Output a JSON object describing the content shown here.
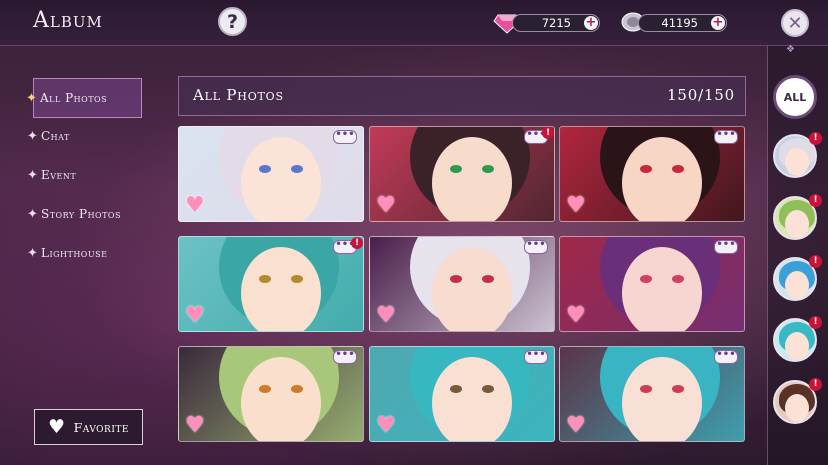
{
  "header": {
    "title": "Album",
    "help_label": "?",
    "close_label": "✕"
  },
  "currencies": [
    {
      "name": "gems",
      "value": "7215",
      "plus": "+",
      "color": "#e84f9d"
    },
    {
      "name": "coins",
      "value": "41195",
      "plus": "+",
      "color": "#b8b3c3"
    }
  ],
  "sidebar": {
    "items": [
      {
        "label": "All Photos",
        "active": true
      },
      {
        "label": "Chat"
      },
      {
        "label": "Event"
      },
      {
        "label": "Story Photos"
      },
      {
        "label": "Lighthouse"
      }
    ],
    "favorite_label": "Favorite"
  },
  "main": {
    "section_title": "All Photos",
    "count": "150/150"
  },
  "photos": [
    {
      "hair": "#e3dbe8",
      "bg": "#d9e2f0",
      "skin": "#fbe3d8",
      "eye": "#5a78c8",
      "chat": "•••",
      "alert": false
    },
    {
      "hair": "#3a2228",
      "bg": "#c23a58",
      "skin": "#f8dccb",
      "eye": "#2f9a4a",
      "chat": "•••",
      "alert": true
    },
    {
      "hair": "#2b1418",
      "bg": "#b0263e",
      "skin": "#f7d6c6",
      "eye": "#c8283a",
      "chat": "•••",
      "alert": false
    },
    {
      "hair": "#3aa7a6",
      "bg": "#6cc2c5",
      "skin": "#f9e0cf",
      "eye": "#b58a2c",
      "chat": "•••",
      "alert": true
    },
    {
      "hair": "#e6e3ec",
      "bg": "#4a1e4a",
      "skin": "#f8dccf",
      "eye": "#c4304a",
      "chat": "•••",
      "alert": false
    },
    {
      "hair": "#6b2f7a",
      "bg": "#a02848",
      "skin": "#f7d5d0",
      "eye": "#d04060",
      "chat": "•••",
      "alert": false
    },
    {
      "hair": "#a9c77a",
      "bg": "#3a2a3c",
      "skin": "#f9dfcc",
      "eye": "#d07a2a",
      "chat": "•••",
      "alert": false
    },
    {
      "hair": "#37b7c0",
      "bg": "#4fa8b2",
      "skin": "#f9e0d2",
      "eye": "#7a5a3a",
      "chat": "•••",
      "alert": false
    },
    {
      "hair": "#38b4c2",
      "bg": "#5b3448",
      "skin": "#f9e0d6",
      "eye": "#d03a5a",
      "chat": "•••",
      "alert": false
    }
  ],
  "avatars": {
    "all_label": "ALL",
    "alert_mark": "!",
    "list": [
      {
        "hair": "#e1dbe6",
        "bg": "#c3d2e6",
        "alert": true
      },
      {
        "hair": "#8fbf58",
        "bg": "#d8e8b0",
        "alert": true
      },
      {
        "hair": "#3b9fd8",
        "bg": "#cfe6f2",
        "alert": true
      },
      {
        "hair": "#39b9c4",
        "bg": "#c6ecef",
        "alert": true
      },
      {
        "hair": "#5a3326",
        "bg": "#e3cdbf",
        "alert": true
      }
    ]
  },
  "icons": {
    "heart": "♥",
    "star": "✦",
    "chat": "•••",
    "alert": "!"
  }
}
